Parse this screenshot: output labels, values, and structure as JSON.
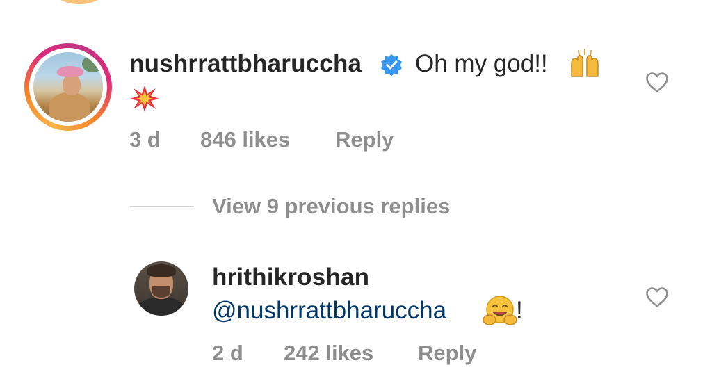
{
  "comments": [
    {
      "username": "nushrrattbharuccha",
      "verified": true,
      "text": "Oh my god!!",
      "emojis": [
        "raising-hands-emoji",
        "collision-emoji"
      ],
      "time": "3 d",
      "likes": "846 likes",
      "reply_label": "Reply"
    },
    {
      "username": "hrithikroshan",
      "mention": "@nushrrattbharuccha",
      "emoji": "hugging-face-emoji",
      "text_suffix": "!",
      "time": "2 d",
      "likes": "242 likes",
      "reply_label": "Reply"
    }
  ],
  "thread": {
    "view_replies_label": "View 9 previous replies"
  },
  "colors": {
    "primary_text": "#262626",
    "secondary_text": "#8e8e8e",
    "mention": "#00376b",
    "verified_badge": "#3897f0"
  },
  "icons": {
    "like": "heart-outline-icon",
    "verified": "verified-badge-icon"
  }
}
